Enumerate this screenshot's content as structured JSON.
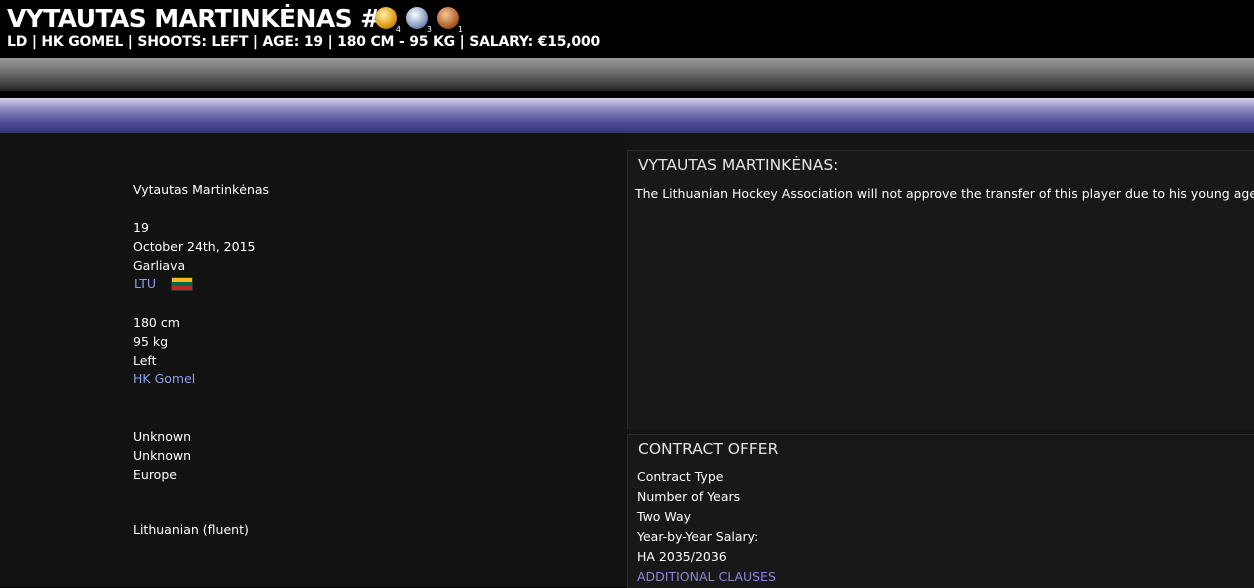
{
  "header": {
    "title": "VYTAUTAS MARTINKĖNAS #0",
    "subtitle": "LD | HK GOMEL | SHOOTS: LEFT | AGE: 19 | 180 CM - 95 KG | SALARY: €15,000",
    "badges": [
      {
        "icon": "gold-award-icon",
        "count": "4",
        "color": "#e0a020"
      },
      {
        "icon": "silver-award-icon",
        "count": "3",
        "color": "#8fa3c7"
      },
      {
        "icon": "bronze-award-icon",
        "count": "1",
        "color": "#b86a32"
      }
    ]
  },
  "profile": {
    "name": "Vytautas Martinkėnas",
    "age": "19",
    "birthdate": "October 24th, 2015",
    "birthplace": "Garliava",
    "nationality": "LTU",
    "flag_colors": [
      "#fdb913",
      "#006a44",
      "#c1272d"
    ],
    "height": "180 cm",
    "weight": "95 kg",
    "shoots": "Left",
    "team": "HK Gomel",
    "unknown_1": "Unknown",
    "unknown_2": "Unknown",
    "region": "Europe",
    "language": "Lithuanian (fluent)"
  },
  "notice": {
    "heading": "VYTAUTAS MARTINKĖNAS:",
    "text": "The Lithuanian Hockey Association will not approve the transfer of this player due to his young age."
  },
  "contract": {
    "heading": "CONTRACT OFFER",
    "contract_type": "Contract Type",
    "years": "Number of Years",
    "two_way": "Two Way",
    "salary_label": "Year-by-Year Salary:",
    "season": "HA 2035/2036",
    "clauses": "ADDITIONAL CLAUSES"
  }
}
